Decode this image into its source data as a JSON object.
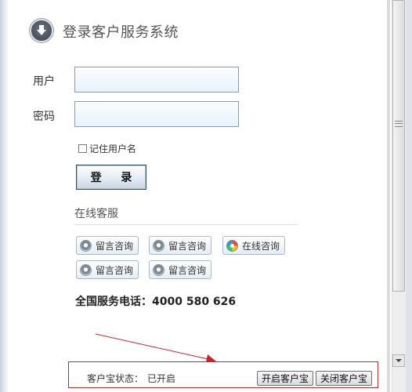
{
  "header": {
    "title": "登录客户服务系统",
    "icon": "download-circle-icon"
  },
  "form": {
    "username_label": "用户",
    "username_value": "",
    "password_label": "密码",
    "password_value": "",
    "remember_label": "记住用户名",
    "login_label": "登 录"
  },
  "online_service": {
    "title": "在线客服",
    "buttons": [
      {
        "label": "留言咨询",
        "icon": "qq-penguin-icon"
      },
      {
        "label": "留言咨询",
        "icon": "qq-penguin-icon"
      },
      {
        "label": "在线咨询",
        "icon": "chat-colorful-icon"
      },
      {
        "label": "留言咨询",
        "icon": "qq-penguin-icon"
      },
      {
        "label": "留言咨询",
        "icon": "qq-penguin-icon"
      }
    ]
  },
  "hotline": "全国服务电话：4000 580 626",
  "status_bar": {
    "label": "客户宝状态：",
    "value": "已开启",
    "open_button": "开启客户宝",
    "close_button": "关闭客户宝"
  },
  "colors": {
    "annotation": "#c4262b",
    "input_border": "#8c9aa8",
    "login_border": "#2f4f68"
  }
}
